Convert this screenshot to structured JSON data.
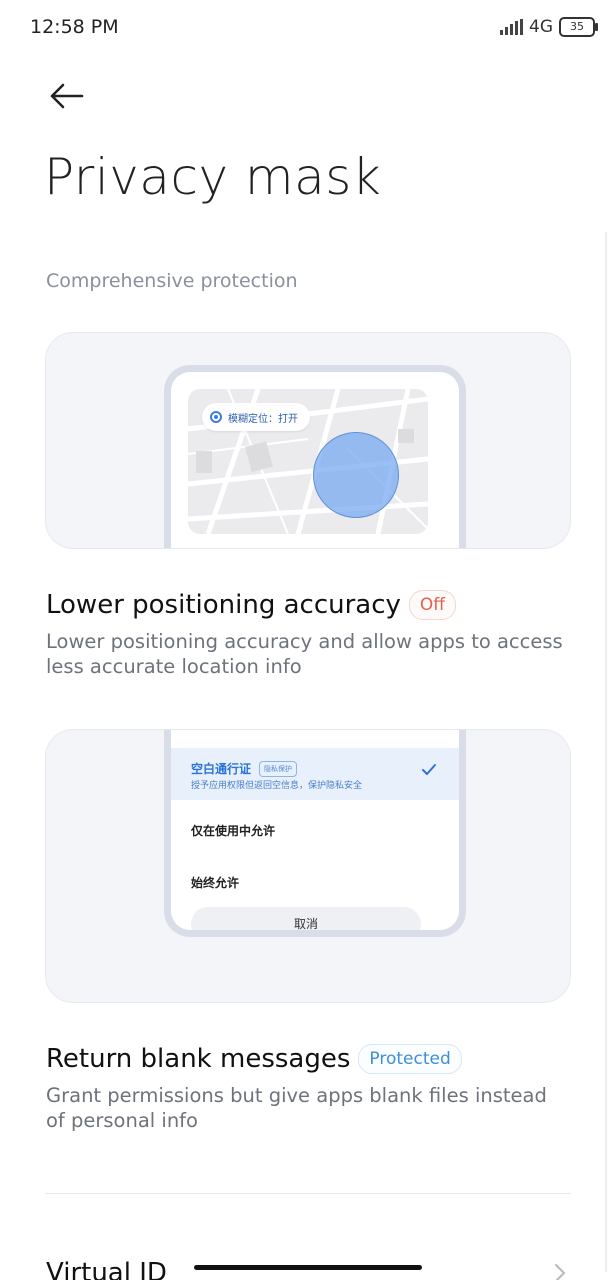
{
  "status_bar": {
    "time": "12:58 PM",
    "network": "4G",
    "battery": "35"
  },
  "header": {
    "back_icon": "arrow-left-icon",
    "title": "Privacy mask"
  },
  "section": {
    "header": "Comprehensive protection"
  },
  "feature_location": {
    "illustration_chip_text": "模糊定位：打开",
    "title": "Lower positioning accuracy",
    "status": "Off",
    "description": "Lower positioning accuracy and allow apps to access less accurate location info"
  },
  "feature_blank": {
    "illustration": {
      "selected_option": "空白通行证",
      "selected_tag": "隐私保护",
      "selected_desc": "授予应用权限但返回空信息，保护隐私安全",
      "option_2": "仅在使用中允许",
      "option_3": "始终允许",
      "cancel": "取消"
    },
    "title": "Return blank messages",
    "status": "Protected",
    "description": "Grant permissions but give apps blank files instead of personal info"
  },
  "next_item": {
    "title": "Virtual ID",
    "icon": "chevron-right-icon"
  },
  "colors": {
    "status_off": "#e0604f",
    "status_protected": "#3d8fd9",
    "accent_blue": "#2a73d8"
  }
}
